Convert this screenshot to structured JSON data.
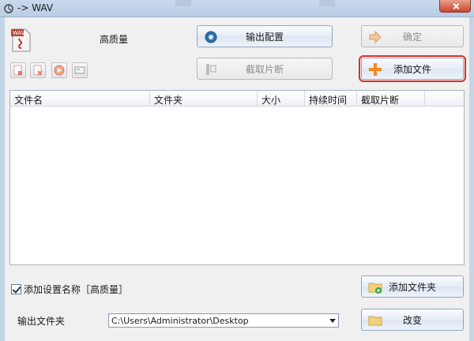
{
  "window": {
    "title": "-> WAV"
  },
  "header": {
    "quality": "高质量",
    "file_type_badge": "WAV"
  },
  "toolbar": {
    "output_config": "输出配置",
    "confirm": "确定",
    "clip": "截取片断",
    "add_file": "添加文件"
  },
  "table": {
    "columns": [
      "文件名",
      "文件夹",
      "大小",
      "持续时间",
      "截取片断"
    ],
    "rows": []
  },
  "footer": {
    "add_setting_name": "添加设置名称［高质量］",
    "add_folder": "添加文件夹",
    "output_folder_label": "输出文件夹",
    "output_folder_value": "C:\\Users\\Administrator\\Desktop",
    "change": "改变"
  },
  "colors": {
    "highlight": "#d8302a",
    "orange_plus": "#f28c1e"
  }
}
